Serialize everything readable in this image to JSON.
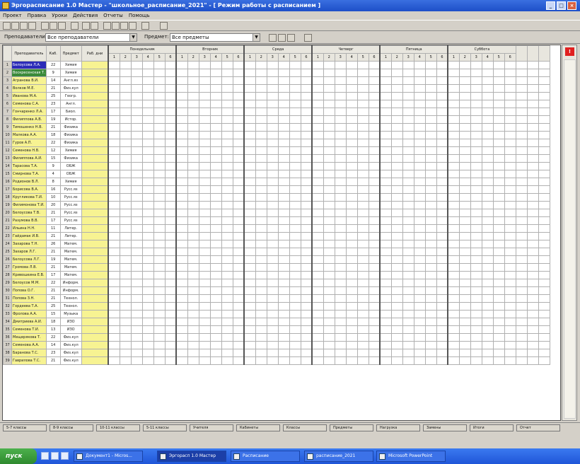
{
  "window": {
    "title": "Эргорасписание 1.0 Мастер - \"школьное_расписание_2021\" - [ Режим работы с расписанием ]"
  },
  "menu": [
    "Проект",
    "Правка",
    "Уроки",
    "Действия",
    "Отчеты",
    "Помощь"
  ],
  "filters": {
    "left_label": "Преподаватели:",
    "left_value": "Все преподаватели",
    "right_label": "Предмет:",
    "right_value": "Все предметы"
  },
  "grid": {
    "headers": [
      "Преподаватель",
      "Каб.",
      "Предмет",
      "Раб. дни"
    ],
    "days": [
      "Понедельник",
      "Вторник",
      "Среда",
      "Четверг",
      "Пятница",
      "Суббота"
    ],
    "periods": [
      "1",
      "2",
      "3",
      "4",
      "5",
      "6"
    ],
    "teachers": [
      {
        "name": "Белоусова Л.А.",
        "room": "22",
        "subj": "Химия"
      },
      {
        "name": "Воскресенская Т.",
        "room": "9",
        "subj": "Химия"
      },
      {
        "name": "Агранова В.И.",
        "room": "14",
        "subj": "Англ.яз"
      },
      {
        "name": "Волков М.Е.",
        "room": "21",
        "subj": "Физ.кул"
      },
      {
        "name": "Иванова М.А.",
        "room": "25",
        "subj": "Геогр."
      },
      {
        "name": "Семенова С.А.",
        "room": "23",
        "subj": "Англ."
      },
      {
        "name": "Гончаренко Л.А.",
        "room": "17",
        "subj": "Биол."
      },
      {
        "name": "Филиппова А.В.",
        "room": "19",
        "subj": "Истор."
      },
      {
        "name": "Тимошенко Н.В.",
        "room": "21",
        "subj": "Физика"
      },
      {
        "name": "Малкова А.А.",
        "room": "18",
        "subj": "Физика"
      },
      {
        "name": "Гуров А.П.",
        "room": "22",
        "subj": "Физика"
      },
      {
        "name": "Семенова Н.В.",
        "room": "12",
        "subj": "Химия"
      },
      {
        "name": "Филиппова А.И.",
        "room": "15",
        "subj": "Физика"
      },
      {
        "name": "Тарасова Т.А.",
        "room": "9",
        "subj": "ОБЖ"
      },
      {
        "name": "Смирнова Т.А.",
        "room": "4",
        "subj": "ОБЖ"
      },
      {
        "name": "Родионов В.Л.",
        "room": "8",
        "subj": "Химия"
      },
      {
        "name": "Борисова В.А.",
        "room": "16",
        "subj": "Русс.яз"
      },
      {
        "name": "Кругликова Т.И.",
        "room": "10",
        "subj": "Русс.яз"
      },
      {
        "name": "Филимонова Т.И.",
        "room": "20",
        "subj": "Русс.яз"
      },
      {
        "name": "Белоусова Т.В.",
        "room": "21",
        "subj": "Русс.яз"
      },
      {
        "name": "Разумова В.В.",
        "room": "17",
        "subj": "Русс.яз"
      },
      {
        "name": "Ильина Н.Н.",
        "room": "11",
        "subj": "Литер."
      },
      {
        "name": "Гайдамак И.В.",
        "room": "21",
        "subj": "Литер."
      },
      {
        "name": "Захарова Т.Н.",
        "room": "26",
        "subj": "Матем."
      },
      {
        "name": "Захаров Л.Г.",
        "room": "21",
        "subj": "Матем."
      },
      {
        "name": "Белоусова Л.Г.",
        "room": "19",
        "subj": "Матем."
      },
      {
        "name": "Громова Л.В.",
        "room": "21",
        "subj": "Матем."
      },
      {
        "name": "Кривошеина Е.В.",
        "room": "17",
        "subj": "Матем."
      },
      {
        "name": "Белоусов М.М.",
        "room": "22",
        "subj": "Информ."
      },
      {
        "name": "Попова О.Г.",
        "room": "21",
        "subj": "Информ."
      },
      {
        "name": "Попова З.Н.",
        "room": "21",
        "subj": "Технол."
      },
      {
        "name": "Гордеева Т.А.",
        "room": "25",
        "subj": "Технол."
      },
      {
        "name": "Фролова А.А.",
        "room": "15",
        "subj": "Музыка"
      },
      {
        "name": "Дмитриева А.И.",
        "room": "18",
        "subj": "ИЗО"
      },
      {
        "name": "Семенова Т.И.",
        "room": "13",
        "subj": "ИЗО"
      },
      {
        "name": "Мещерякова Т.",
        "room": "22",
        "subj": "Физ.кул"
      },
      {
        "name": "Семенова А.А.",
        "room": "14",
        "subj": "Физ.кул"
      },
      {
        "name": "Баранова Т.С.",
        "room": "23",
        "subj": "Физ.кул"
      },
      {
        "name": "Гаврилова Т.С.",
        "room": "21",
        "subj": "Физ.кул"
      }
    ],
    "selected_row": 1,
    "second_selected_row": 2
  },
  "sheet_tabs": [
    "5-7 классы",
    "8-9 классы",
    "10-11 классы",
    "5-11 классы",
    "Учителя",
    "Кабинеты",
    "Классы",
    "Предметы",
    "Нагрузка",
    "Замены",
    "Итоги",
    "Отчет"
  ],
  "taskbar": {
    "start": "пуск",
    "tasks": [
      "Документ1 - Micros...",
      "Эргорасп 1.0 Мастер",
      "Расписание",
      "расписание_2021",
      "Microsoft PowerPoint"
    ]
  },
  "colors": {
    "highlight": "#f0a8a8",
    "name_column": "#f7f392",
    "selected": "#2b2bb8",
    "title_bar": "#1d4fc8"
  }
}
